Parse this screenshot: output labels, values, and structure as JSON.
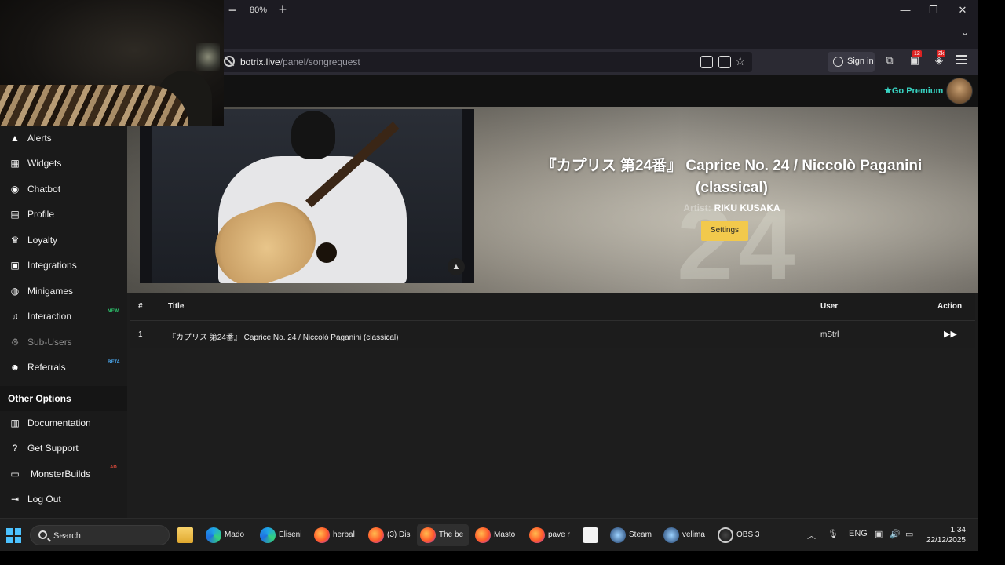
{
  "browser": {
    "zoom_level": "80%",
    "zoom_minus": "−",
    "zoom_plus": "+",
    "window_buttons": [
      "—",
      "❐",
      "✕"
    ],
    "url_host": "botrix.live",
    "url_path": "/panel/songrequest",
    "sign_in_label": "Sign in",
    "extension_badges": [
      "12",
      "2k"
    ]
  },
  "header": {
    "premium_label": "Go Premium"
  },
  "sidebar": {
    "items": [
      {
        "label": "Alerts",
        "icon": "warning-icon"
      },
      {
        "label": "Widgets",
        "icon": "widgets-icon"
      },
      {
        "label": "Chatbot",
        "icon": "robot-icon"
      },
      {
        "label": "Profile",
        "icon": "profile-card-icon"
      },
      {
        "label": "Loyalty",
        "icon": "trophy-icon"
      },
      {
        "label": "Integrations",
        "icon": "integrations-icon"
      },
      {
        "label": "Minigames",
        "icon": "gamepad-icon"
      },
      {
        "label": "Interaction",
        "icon": "music-note-icon",
        "badge": "NEW"
      },
      {
        "label": "Sub-Users",
        "icon": "users-cog-icon"
      },
      {
        "label": "Referrals",
        "icon": "users-icon",
        "badge": "BETA"
      }
    ],
    "section_title": "Other Options",
    "other_items": [
      {
        "label": "Documentation",
        "icon": "docs-icon"
      },
      {
        "label": "Get Support",
        "icon": "question-icon"
      },
      {
        "label": "MonsterBuilds",
        "icon": "laptop-icon",
        "badge": "AD"
      },
      {
        "label": "Log Out",
        "icon": "logout-icon"
      }
    ]
  },
  "now_playing": {
    "title": "『カプリス 第24番』 Caprice No. 24 / Niccolò Paganini (classical)",
    "artist_prefix": "Artist:",
    "artist": "RIKU KUSAKA",
    "settings_label": "Settings"
  },
  "queue": {
    "headers": {
      "num": "#",
      "title": "Title",
      "user": "User",
      "action": "Action"
    },
    "rows": [
      {
        "num": "1",
        "title": "『カプリス 第24番』 Caprice No. 24 / Niccolò Paganini (classical)",
        "user": "mStrl"
      }
    ]
  },
  "taskbar": {
    "search_label": "Search",
    "apps": [
      {
        "label": "Mado",
        "icon": "edge-icon"
      },
      {
        "label": "Eliseni",
        "icon": "edge-icon"
      },
      {
        "label": "herbal",
        "icon": "firefox-icon"
      },
      {
        "label": "(3) Dis",
        "icon": "firefox-icon"
      },
      {
        "label": "The be",
        "icon": "firefox-icon"
      },
      {
        "label": "Masto",
        "icon": "firefox-icon"
      },
      {
        "label": "pave r",
        "icon": "firefox-icon"
      },
      {
        "label": "Steam",
        "icon": "steam-icon"
      },
      {
        "label": "velima",
        "icon": "steam-icon"
      },
      {
        "label": "OBS 3",
        "icon": "obs-icon"
      }
    ],
    "language": "ENG",
    "time": "1.34",
    "date": "22/12/2025"
  },
  "colors": {
    "accent_teal": "#38d3c2",
    "settings_yellow": "#f2c94c",
    "badge_green": "#2ecc71",
    "badge_blue": "#4fb3ff",
    "badge_red": "#e74c3c"
  }
}
